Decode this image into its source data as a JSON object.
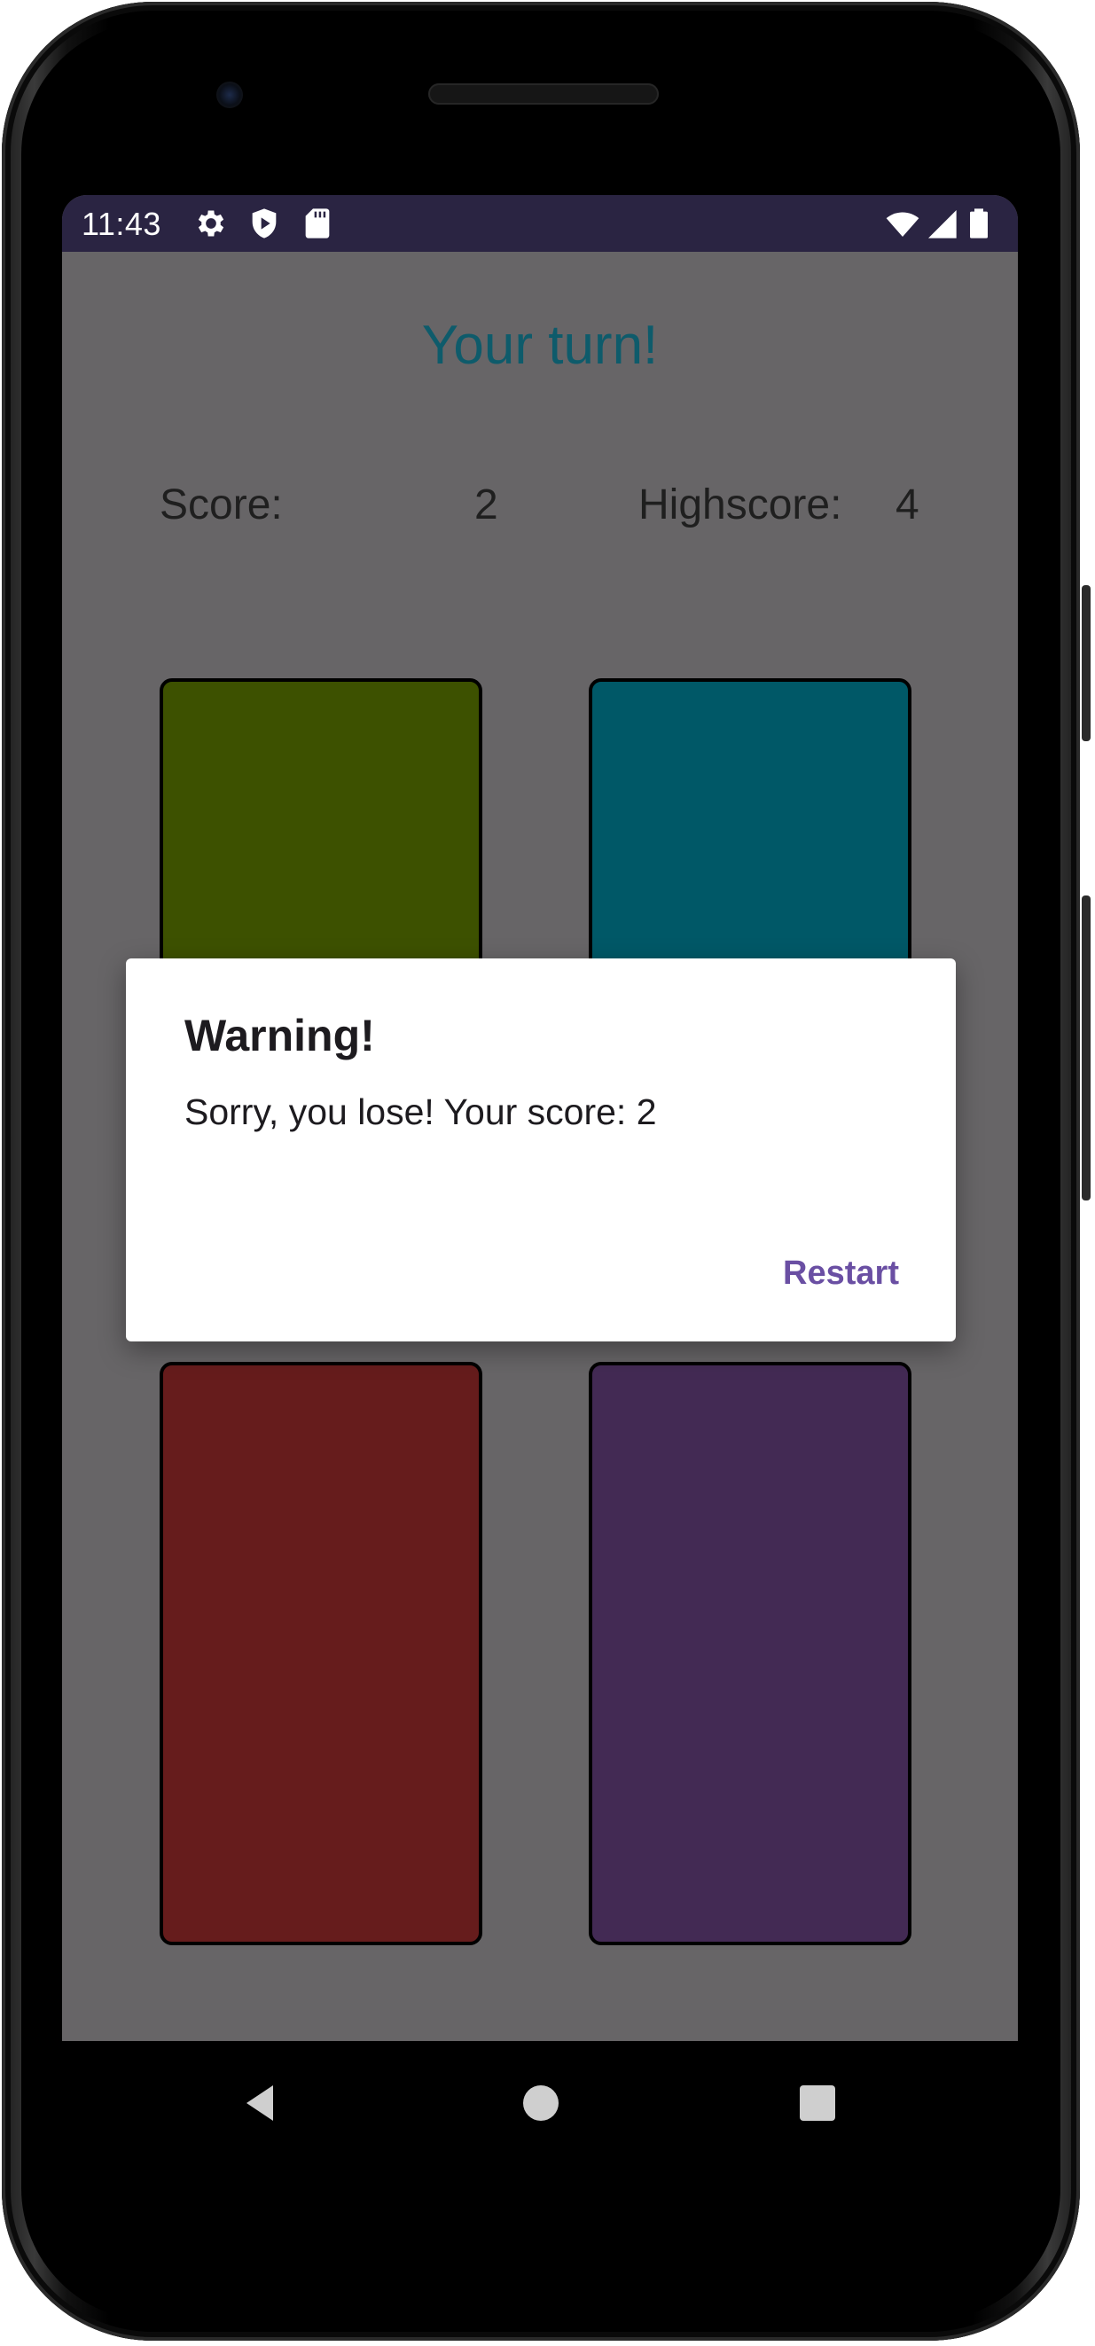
{
  "status_bar": {
    "time": "11:43",
    "left_icons": [
      "gear-icon",
      "shield-icon",
      "sd-card-icon"
    ],
    "right_icons": [
      "wifi-icon",
      "cellular-signal-icon",
      "battery-icon"
    ],
    "background": "#2a2442"
  },
  "game": {
    "turn_text": "Your turn!",
    "score_label": "Score:",
    "score_value": "2",
    "highscore_label": "Highscore:",
    "highscore_value": "4",
    "tiles": [
      {
        "name": "green",
        "color": "#3d5100"
      },
      {
        "name": "teal",
        "color": "#005867"
      },
      {
        "name": "red",
        "color": "#661c1c"
      },
      {
        "name": "purple",
        "color": "#432a54"
      }
    ]
  },
  "dialog": {
    "title": "Warning!",
    "message": "Sorry, you lose! Your score: 2",
    "action_label": "Restart",
    "accent": "#6a4fa3"
  },
  "nav_bar": {
    "buttons": [
      "back-icon",
      "home-icon",
      "recents-icon"
    ]
  }
}
